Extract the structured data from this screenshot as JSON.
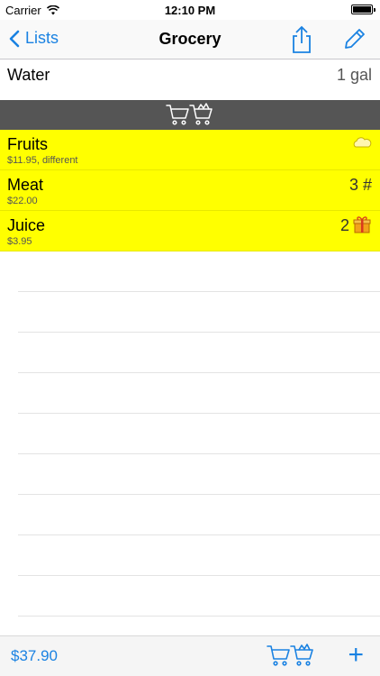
{
  "status_bar": {
    "carrier": "Carrier",
    "time": "12:10 PM"
  },
  "nav": {
    "back_label": "Lists",
    "title": "Grocery"
  },
  "unchecked_items": [
    {
      "name": "Water",
      "quantity": "1 gal"
    }
  ],
  "checked_items": [
    {
      "name": "Fruits",
      "subtitle": "$11.95, different",
      "quantity": "",
      "icon": "cloud-icon"
    },
    {
      "name": "Meat",
      "subtitle": "$22.00",
      "quantity": "3 #",
      "icon": ""
    },
    {
      "name": "Juice",
      "subtitle": "$3.95",
      "quantity": "2",
      "icon": "gift-icon"
    }
  ],
  "toolbar": {
    "total": "$37.90",
    "add_label": "+"
  },
  "colors": {
    "accent": "#1a82e2",
    "checked_bg": "#ffff00",
    "separator_bg": "#555555"
  }
}
